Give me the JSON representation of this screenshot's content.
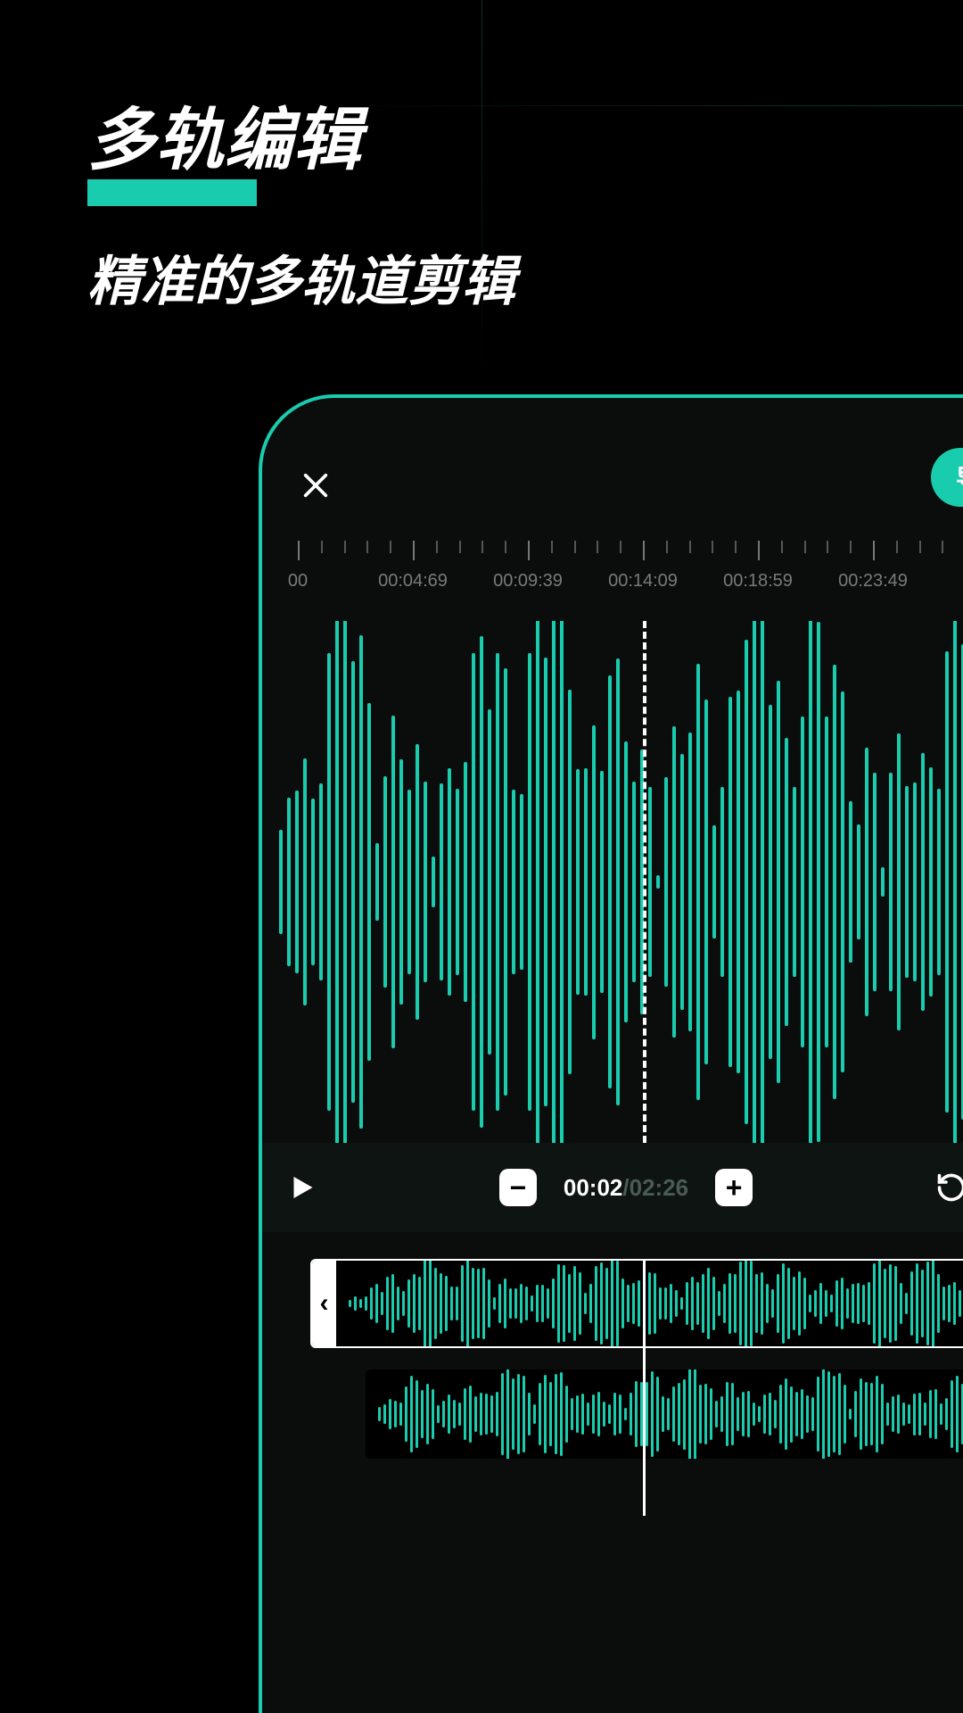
{
  "hero": {
    "title": "多轨编辑",
    "subtitle": "精准的多轨道剪辑"
  },
  "editor": {
    "export_label": "导",
    "ruler_labels": [
      "00",
      "00:04:69",
      "00:09:39",
      "00:14:09",
      "00:18:59",
      "00:23:49"
    ],
    "time_current": "00:02",
    "time_separator": "/",
    "time_total": "02:26",
    "minus_label": "−",
    "plus_label": "+",
    "track_handle": "‹"
  },
  "colors": {
    "accent": "#1accae"
  }
}
